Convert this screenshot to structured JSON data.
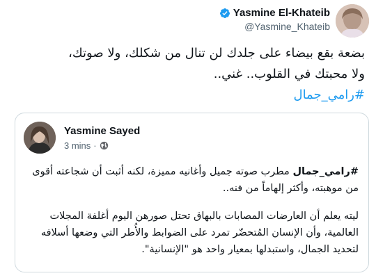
{
  "author": {
    "name": "Yasmine El-Khateib",
    "handle": "@Yasmine_Khateib",
    "verified": true,
    "verified_color": "#1d9bf0"
  },
  "tweet": {
    "line1": "بضعة بقع بيضاء على جلدك لن تنال من شكلك، ولا صوتك،",
    "line2": "ولا محبتك في القلوب.. غني..",
    "hashtag": "#رامي_جمال",
    "hashtag_color": "#1d9bf0"
  },
  "quote": {
    "name": "Yasmine Sayed",
    "time": "3 mins",
    "separator": "·",
    "audience_icon": "globe-icon",
    "para1_hashtag": "#رامي_جمال",
    "para1_rest": " مطرب صوته جميل وأغانيه مميزة، لكنه أثبت أن شجاعته أقوى من موهبته، وأكثر إلهاماً من فنه..",
    "para2": "ليته يعلم أن العارضات المصابات بالبهاق تحتل صورهن اليوم أغلفة المجلات العالمية، وأن الإنسان المُتحضّر تمرد على الضوابط والأُطر التي وضعها أسلافه لتحديد الجمال، واستبدلها بمعيار واحد هو \"الإنسانية\"."
  }
}
